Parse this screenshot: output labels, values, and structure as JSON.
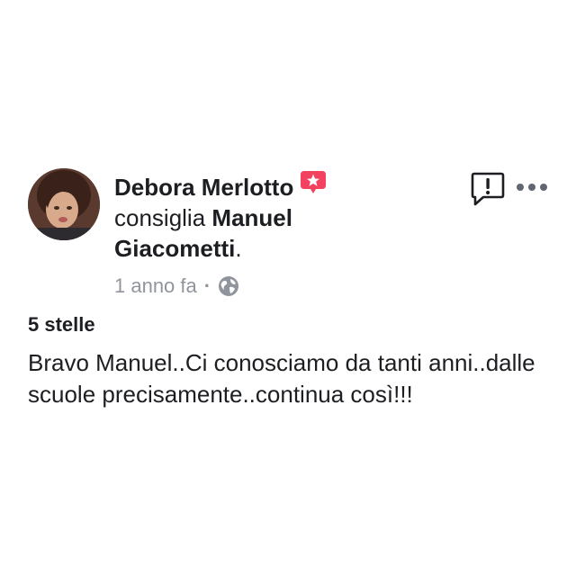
{
  "post": {
    "author": "Debora Merlotto",
    "verb": "consiglia",
    "page_name": "Manuel Giacometti",
    "page_name_suffix": ".",
    "timestamp": "1 anno fa",
    "separator": "·",
    "privacy_icon": "globe-icon",
    "recommend_badge_icon": "star-speech-bubble-icon",
    "rating": "5 stelle",
    "text": "Bravo Manuel..Ci conosciamo da tanti anni..dalle scuole precisamente..continua così!!!"
  },
  "actions": {
    "report_icon": "exclamation-speech-bubble-icon",
    "more_icon": "more-dots-icon"
  },
  "colors": {
    "text": "#1c1e21",
    "meta": "#90949c",
    "badge": "#f3425f",
    "icon": "#1c1e21"
  }
}
